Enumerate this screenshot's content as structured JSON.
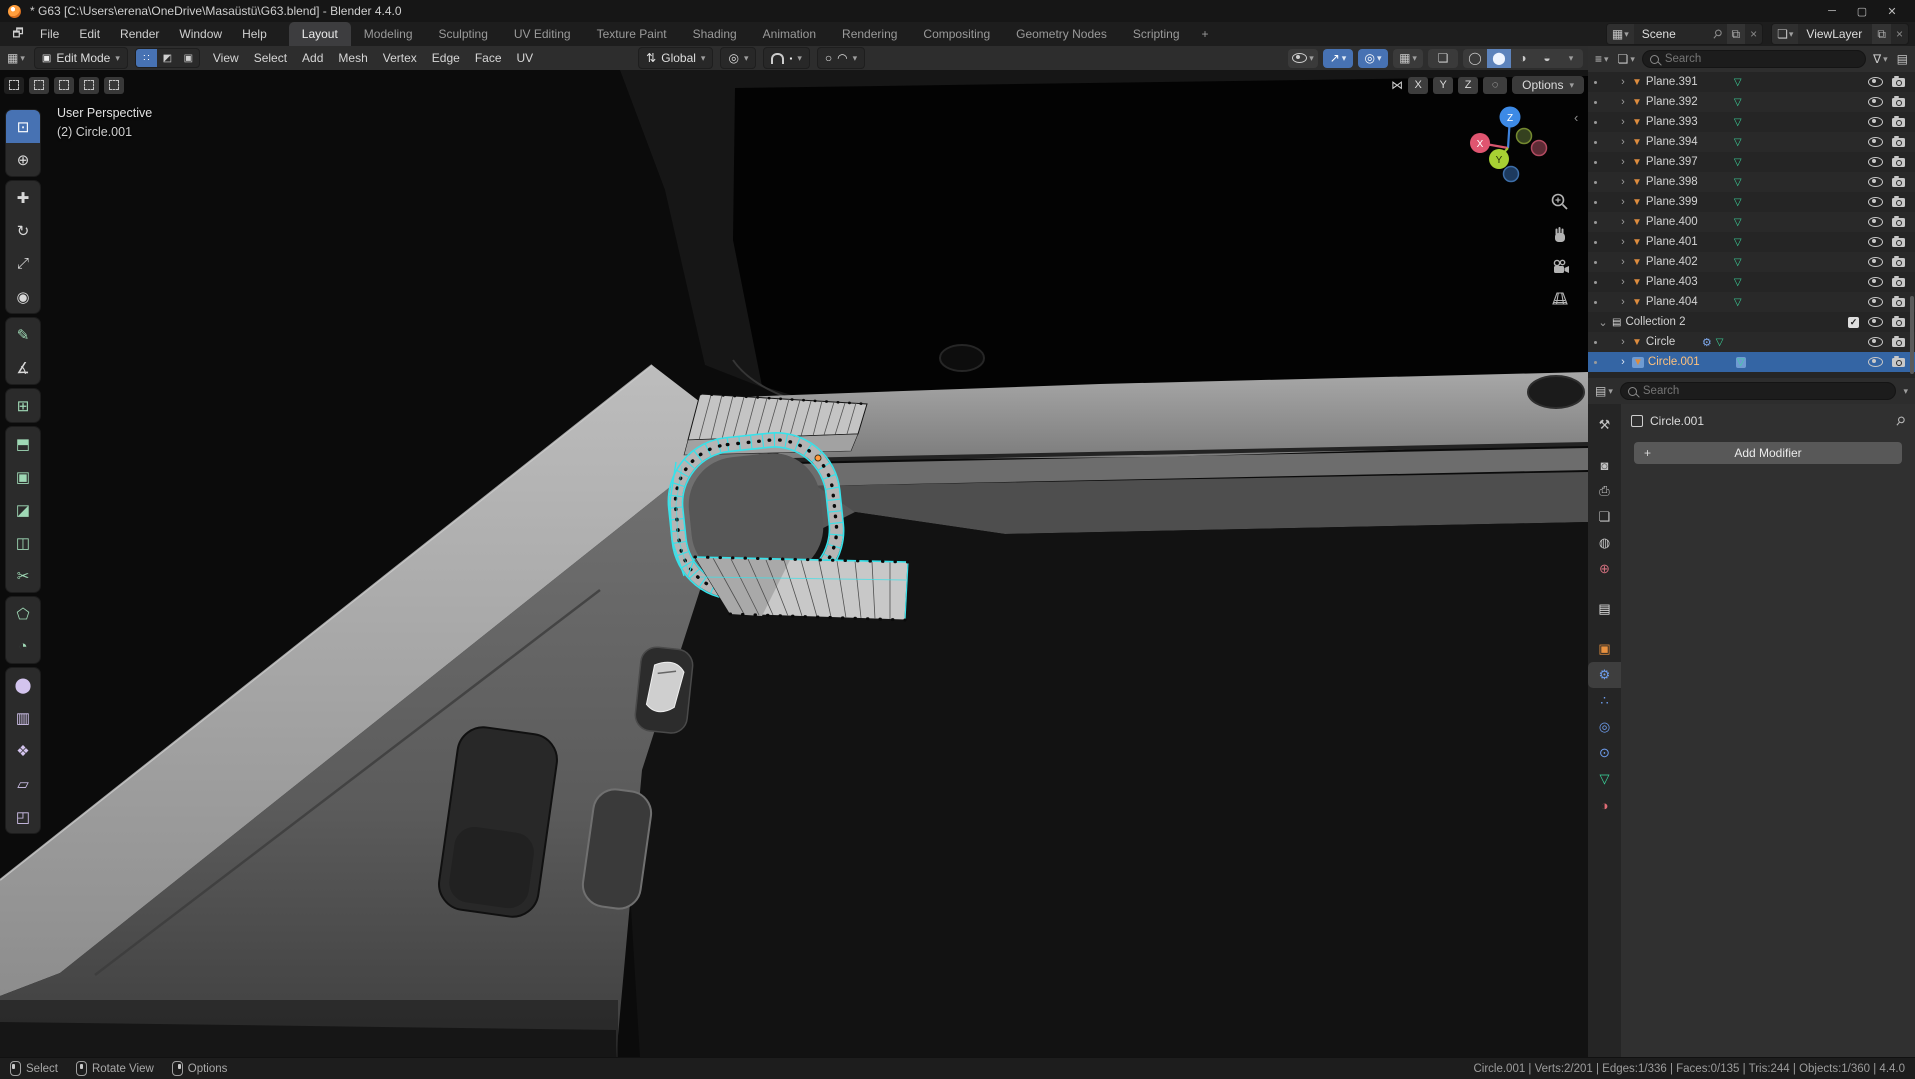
{
  "titlebar": {
    "title": "* G63 [C:\\Users\\erena\\OneDrive\\Masaüstü\\G63.blend] - Blender 4.4.0",
    "minimize": "─",
    "maximize": "▢",
    "close": "✕"
  },
  "topbar": {
    "menus": [
      "File",
      "Edit",
      "Render",
      "Window",
      "Help"
    ],
    "tabs": [
      "Layout",
      "Modeling",
      "Sculpting",
      "UV Editing",
      "Texture Paint",
      "Shading",
      "Animation",
      "Rendering",
      "Compositing",
      "Geometry Nodes",
      "Scripting"
    ],
    "active_tab": "Layout",
    "add_tab_label": "+",
    "scene_selector": {
      "label": "Scene"
    },
    "viewlayer_selector": {
      "label": "ViewLayer"
    }
  },
  "viewport_header": {
    "mode_label": "Edit Mode",
    "menus": [
      "View",
      "Select",
      "Add",
      "Mesh",
      "Vertex",
      "Edge",
      "Face",
      "UV"
    ],
    "orientation_label": "Global"
  },
  "tool_settings": {
    "mirror_axes": [
      "X",
      "Y",
      "Z"
    ],
    "options_label": "Options"
  },
  "viewport": {
    "overlay_line1": "User Perspective",
    "overlay_line2": "(2) Circle.001",
    "gizmo_axes": {
      "x": "X",
      "y": "Y",
      "z": "Z"
    }
  },
  "toolbar": {
    "tools": [
      {
        "name": "select-box",
        "glyph": "⊡"
      },
      {
        "name": "cursor",
        "glyph": "⊕"
      },
      {
        "name": "move",
        "glyph": "✚"
      },
      {
        "name": "rotate",
        "glyph": "↻"
      },
      {
        "name": "scale",
        "glyph": "⤢"
      },
      {
        "name": "transform",
        "glyph": "◉"
      },
      {
        "name": "annotate",
        "glyph": "✎"
      },
      {
        "name": "measure",
        "glyph": "∡"
      },
      {
        "name": "add-cube",
        "glyph": "⊞"
      },
      {
        "name": "extrude-region",
        "glyph": "⬒"
      },
      {
        "name": "inset-faces",
        "glyph": "▣"
      },
      {
        "name": "bevel",
        "glyph": "◪"
      },
      {
        "name": "loop-cut",
        "glyph": "◫"
      },
      {
        "name": "knife",
        "glyph": "✂"
      },
      {
        "name": "poly-build",
        "glyph": "⬠"
      },
      {
        "name": "spin",
        "glyph": "◔"
      },
      {
        "name": "smooth",
        "glyph": "⬤"
      },
      {
        "name": "edge-slide",
        "glyph": "▥"
      },
      {
        "name": "shrink-fatten",
        "glyph": "❖"
      },
      {
        "name": "shear",
        "glyph": "▱"
      },
      {
        "name": "rip-region",
        "glyph": "◰"
      }
    ]
  },
  "outliner": {
    "search_placeholder": "Search",
    "rows": [
      {
        "label": "Plane.391"
      },
      {
        "label": "Plane.392"
      },
      {
        "label": "Plane.393"
      },
      {
        "label": "Plane.394"
      },
      {
        "label": "Plane.397"
      },
      {
        "label": "Plane.398"
      },
      {
        "label": "Plane.399"
      },
      {
        "label": "Plane.400"
      },
      {
        "label": "Plane.401"
      },
      {
        "label": "Plane.402"
      },
      {
        "label": "Plane.403"
      },
      {
        "label": "Plane.404"
      },
      {
        "label": "Collection 2"
      },
      {
        "label": "Circle"
      },
      {
        "label": "Circle.001"
      }
    ]
  },
  "properties": {
    "search_placeholder": "Search",
    "breadcrumb": "Circle.001",
    "add_modifier_label": "Add Modifier",
    "add_modifier_plus": "+",
    "active_tab": "modifiers",
    "tabs": [
      {
        "name": "tool",
        "glyph": "⚒"
      },
      {
        "name": "render",
        "glyph": "◙"
      },
      {
        "name": "output",
        "glyph": "⎙"
      },
      {
        "name": "view-layer",
        "glyph": "❏"
      },
      {
        "name": "scene",
        "glyph": "◍"
      },
      {
        "name": "world",
        "glyph": "⊕"
      },
      {
        "name": "collection",
        "glyph": "▤"
      },
      {
        "name": "object",
        "glyph": "▣"
      },
      {
        "name": "modifiers",
        "glyph": "⚙"
      },
      {
        "name": "particles",
        "glyph": "∴"
      },
      {
        "name": "physics",
        "glyph": "◎"
      },
      {
        "name": "constraints",
        "glyph": "⊙"
      },
      {
        "name": "object-data",
        "glyph": "▽"
      },
      {
        "name": "material",
        "glyph": "◑"
      }
    ]
  },
  "status_bar": {
    "hints": [
      {
        "button": "left",
        "label": "Select"
      },
      {
        "button": "middle",
        "label": "Rotate View"
      },
      {
        "button": "right",
        "label": "Options"
      }
    ],
    "stats": "Circle.001 | Verts:2/201 | Edges:1/336 | Faces:0/135 | Tris:244 | Objects:1/360 | 4.4.0"
  },
  "colors": {
    "accent_blue": "#4772b3",
    "selected_row": "#3465a4",
    "active_object_text": "#ffc27d",
    "mesh_icon_orange": "#dd8c3e",
    "mesh_data_green": "#3bd69c",
    "edit_edge_cyan": "#37e2ea",
    "gizmo_x_red": "#e05570",
    "gizmo_y_green": "#a7d133",
    "gizmo_z_blue": "#3d8ae6"
  }
}
